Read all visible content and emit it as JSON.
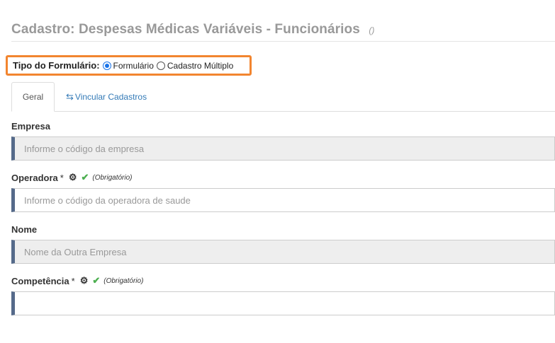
{
  "header": {
    "title": "Cadastro: Despesas Médicas Variáveis - Funcionários",
    "count": "()"
  },
  "form_type": {
    "label": "Tipo do Formulário:",
    "options": [
      {
        "label": "Formulário",
        "selected": true
      },
      {
        "label": "Cadastro Múltiplo",
        "selected": false
      }
    ]
  },
  "tabs": [
    {
      "label": "Geral",
      "active": true
    },
    {
      "label": "Vincular Cadastros",
      "active": false,
      "icon": "retweet-icon"
    }
  ],
  "fields": {
    "empresa": {
      "label": "Empresa",
      "placeholder": "Informe o código da empresa",
      "disabled": true
    },
    "operadora": {
      "label": "Operadora",
      "required_mark": "*",
      "obrigatorio": "(Obrigatório)",
      "placeholder": "Informe o código da operadora de saude",
      "disabled": false
    },
    "nome": {
      "label": "Nome",
      "placeholder": "Nome da Outra Empresa",
      "disabled": true
    },
    "competencia": {
      "label": "Competência",
      "required_mark": "*",
      "obrigatorio": "(Obrigatório)",
      "placeholder": "",
      "disabled": false
    }
  },
  "colors": {
    "accent_border": "#f2852f",
    "input_left_bar": "#556a8a",
    "link": "#337ab7",
    "check": "#4caf50"
  }
}
